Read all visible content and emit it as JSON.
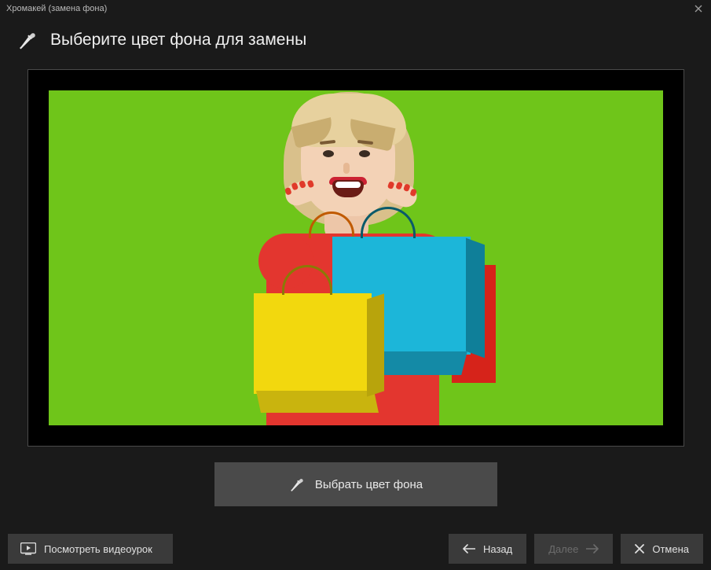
{
  "window": {
    "title": "Хромакей (замена фона)"
  },
  "header": {
    "title": "Выберите цвет фона для замены"
  },
  "actions": {
    "pick_color": "Выбрать цвет фона"
  },
  "footer": {
    "tutorial": "Посмотреть видеоурок",
    "back": "Назад",
    "next": "Далее",
    "cancel": "Отмена"
  },
  "preview": {
    "background_color": "#6fc51a"
  }
}
